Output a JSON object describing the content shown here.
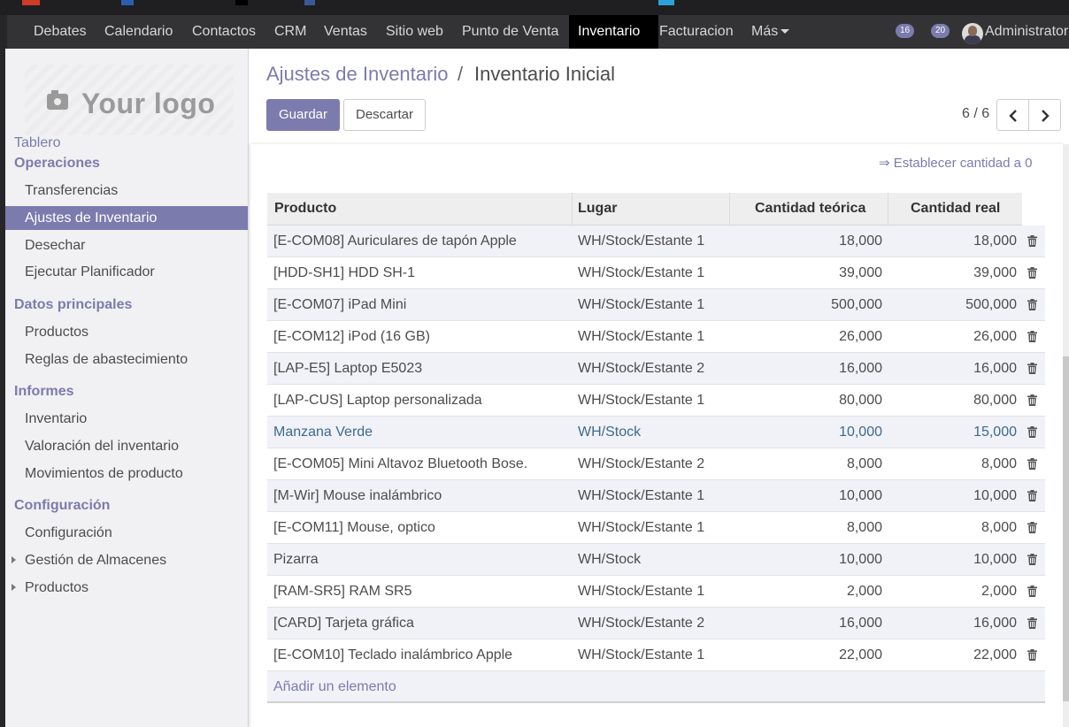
{
  "menu": {
    "items": [
      "Debates",
      "Calendario",
      "Contactos",
      "CRM",
      "Ventas",
      "Sitio web",
      "Punto de Venta",
      "Inventario",
      "Facturacion",
      "Más"
    ],
    "active": "Inventario",
    "badge_activity": "16",
    "badge_messages": "20",
    "user_name": "Administrator"
  },
  "sidebar": {
    "logo_text": "Your logo",
    "tablero": "Tablero",
    "sections": [
      {
        "title": "Operaciones",
        "items": [
          "Transferencias",
          "Ajustes de Inventario",
          "Desechar",
          "Ejecutar Planificador"
        ]
      },
      {
        "title": "Datos principales",
        "items": [
          "Productos",
          "Reglas de abastecimiento"
        ]
      },
      {
        "title": "Informes",
        "items": [
          "Inventario",
          "Valoración del inventario",
          "Movimientos de producto"
        ]
      },
      {
        "title": "Configuración",
        "items": [
          "Configuración",
          "Gestión de Almacenes",
          "Productos"
        ]
      }
    ],
    "active_item": "Ajustes de Inventario"
  },
  "breadcrumb": {
    "parent": "Ajustes de Inventario",
    "separator": "/",
    "current": "Inventario Inicial"
  },
  "buttons": {
    "save": "Guardar",
    "discard": "Descartar"
  },
  "pager": {
    "value": "6 / 6"
  },
  "set_zero_link": "⇒ Establecer cantidad a 0",
  "table": {
    "columns": [
      "Producto",
      "Lugar",
      "Cantidad teórica",
      "Cantidad real"
    ],
    "rows": [
      {
        "product": "[E-COM08] Auriculares de tapón Apple",
        "location": "WH/Stock/Estante 1",
        "theoretical": "18,000",
        "real": "18,000"
      },
      {
        "product": "[HDD-SH1] HDD SH-1",
        "location": "WH/Stock/Estante 1",
        "theoretical": "39,000",
        "real": "39,000"
      },
      {
        "product": "[E-COM07] iPad Mini",
        "location": "WH/Stock/Estante 1",
        "theoretical": "500,000",
        "real": "500,000"
      },
      {
        "product": "[E-COM12] iPod (16 GB)",
        "location": "WH/Stock/Estante 1",
        "theoretical": "26,000",
        "real": "26,000"
      },
      {
        "product": "[LAP-E5] Laptop E5023",
        "location": "WH/Stock/Estante 2",
        "theoretical": "16,000",
        "real": "16,000"
      },
      {
        "product": "[LAP-CUS] Laptop personalizada",
        "location": "WH/Stock/Estante 1",
        "theoretical": "80,000",
        "real": "80,000"
      },
      {
        "product": "Manzana Verde",
        "location": "WH/Stock",
        "theoretical": "10,000",
        "real": "15,000"
      },
      {
        "product": "[E-COM05] Mini Altavoz Bluetooth Bose.",
        "location": "WH/Stock/Estante 2",
        "theoretical": "8,000",
        "real": "8,000"
      },
      {
        "product": "[M-Wir] Mouse inalámbrico",
        "location": "WH/Stock/Estante 1",
        "theoretical": "10,000",
        "real": "10,000"
      },
      {
        "product": "[E-COM11] Mouse, optico",
        "location": "WH/Stock/Estante 1",
        "theoretical": "8,000",
        "real": "8,000"
      },
      {
        "product": "Pizarra",
        "location": "WH/Stock",
        "theoretical": "10,000",
        "real": "10,000"
      },
      {
        "product": "[RAM-SR5] RAM SR5",
        "location": "WH/Stock/Estante 1",
        "theoretical": "2,000",
        "real": "2,000"
      },
      {
        "product": "[CARD] Tarjeta gráfica",
        "location": "WH/Stock/Estante 2",
        "theoretical": "16,000",
        "real": "16,000"
      },
      {
        "product": "[E-COM10] Teclado inalámbrico Apple",
        "location": "WH/Stock/Estante 1",
        "theoretical": "22,000",
        "real": "22,000"
      }
    ],
    "add_line": "Añadir un elemento"
  },
  "colors": {
    "accent": "#7c7bad",
    "menubar": "#333336",
    "changed_row_text": "#3c6a8f"
  }
}
